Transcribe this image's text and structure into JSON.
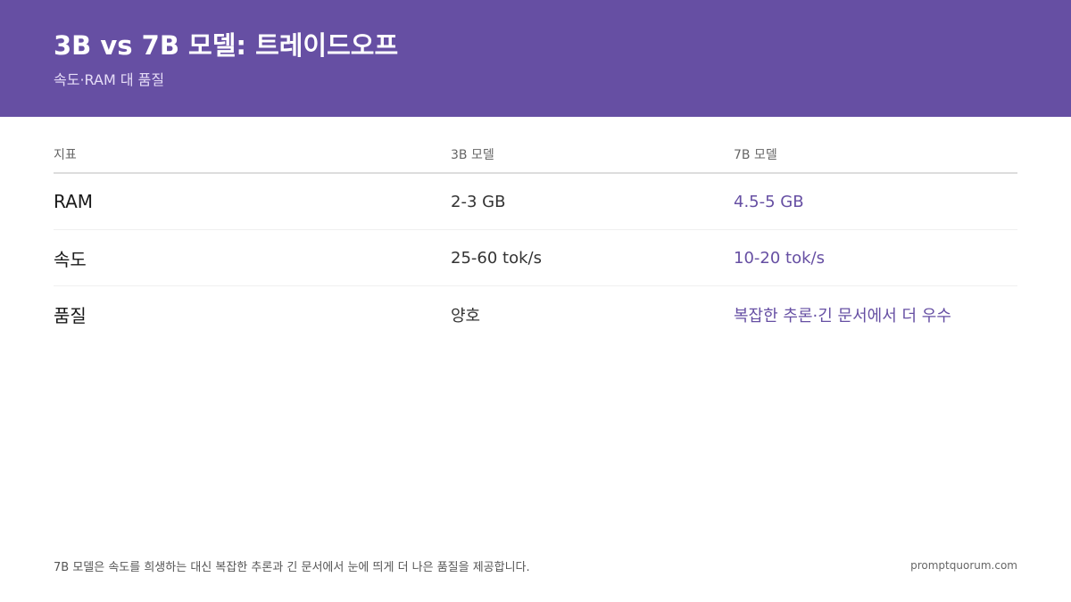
{
  "header": {
    "title": "3B vs 7B 모델: 트레이드오프",
    "subtitle": "속도·RAM 대 품질",
    "background_color": "#664fa3"
  },
  "table": {
    "columns": [
      "지표",
      "3B 모델",
      "7B 모델"
    ],
    "rows": [
      {
        "metric": "RAM",
        "model_3b": "2-3 GB",
        "model_7b": "4.5-5 GB"
      },
      {
        "metric": "속도",
        "model_3b": "25-60 tok/s",
        "model_7b": "10-20 tok/s"
      },
      {
        "metric": "품질",
        "model_3b": "양호",
        "model_7b": "복잡한 추론·긴 문서에서 더 우수"
      }
    ],
    "highlight_color": "#664fa3"
  },
  "footer": {
    "note": "7B 모델은 속도를 희생하는 대신 복잡한 추론과 긴 문서에서 눈에 띄게 더 나은 품질을 제공합니다.",
    "brand": "promptquorum.com"
  }
}
